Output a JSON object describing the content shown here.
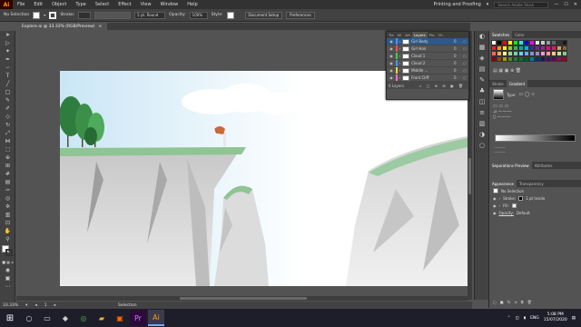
{
  "app": {
    "logo": "Ai",
    "menus": [
      "File",
      "Edit",
      "Object",
      "Type",
      "Select",
      "Effect",
      "View",
      "Window",
      "Help"
    ],
    "workspace": "Printing and Proofing",
    "search_placeholder": "Search Adobe Stock"
  },
  "control": {
    "selection": "No Selection",
    "stroke_label": "Stroke:",
    "stroke_value": "",
    "brush_value": "5 pt. Round",
    "opacity_label": "Opacity:",
    "opacity_value": "100%",
    "style_label": "Style:",
    "doc_setup": "Document Setup",
    "preferences": "Preferences"
  },
  "document": {
    "tab_title": "Explore.ai @ 33.33% (RGB/Preview)",
    "close": "×"
  },
  "layers_panel": {
    "tabs": [
      "Tra",
      "Ali",
      "Art",
      "Layers",
      "Pro",
      "Ch"
    ],
    "active_tab": "Layers",
    "layers": [
      {
        "name": "Girl Body",
        "count": "0",
        "color": "#4f8fff",
        "selected": true
      },
      {
        "name": "Girl Hair",
        "count": "0",
        "color": "#ff5050",
        "selected": false
      },
      {
        "name": "Cloud 1",
        "count": "0",
        "color": "#3fd04f",
        "selected": false
      },
      {
        "name": "Cloud 2",
        "count": "0",
        "color": "#4f8fff",
        "selected": false
      },
      {
        "name": "Middle ...",
        "count": "0",
        "color": "#ffcf3f",
        "selected": false
      },
      {
        "name": "Front Cliff",
        "count": "0",
        "color": "#ff6fd0",
        "selected": false
      }
    ],
    "footer": "6 Layers"
  },
  "right_panels": {
    "swatches_tabs": [
      "Swatches",
      "Color"
    ],
    "swatch_colors": [
      "#ffffff",
      "#000000",
      "#ff0000",
      "#ffff00",
      "#00ff00",
      "#00ffff",
      "#0000ff",
      "#ff00ff",
      "#e6e6e6",
      "#cccccc",
      "#999999",
      "#666666",
      "#333333",
      "#1a1a1a",
      "#ed1c24",
      "#f7941d",
      "#fff200",
      "#8dc63f",
      "#39b54a",
      "#00a99d",
      "#00aeef",
      "#2e3192",
      "#662d91",
      "#92278f",
      "#ec008c",
      "#ed145b",
      "#c69c6d",
      "#8c6239",
      "#f26c4f",
      "#fbaf5d",
      "#fff799",
      "#a3d39c",
      "#7accc8",
      "#6dcff6",
      "#7da7d9",
      "#8493ca",
      "#a187be",
      "#f49ac1",
      "#f5989d",
      "#fdc689",
      "#c4df9b",
      "#82ca9c",
      "#8b0000",
      "#a0410d",
      "#aba000",
      "#598527",
      "#197b30",
      "#007236",
      "#005e20",
      "#0076a3",
      "#003471",
      "#1b1464",
      "#440e62",
      "#630460",
      "#9e005d",
      "#a0001f"
    ],
    "stroke_tab": "Stroke",
    "gradient_tab": "Gradient",
    "gradient_type_label": "Type:",
    "sep_tabs": [
      "Separations Preview",
      "Attributes"
    ],
    "appearance_tabs": [
      "Appearance",
      "Transparency"
    ],
    "appearance_title": "No Selection",
    "appearance_stroke_label": "Stroke:",
    "appearance_stroke_value": "1 pt  Inside",
    "appearance_fill_label": "Fill:",
    "appearance_opacity_label": "Opacity:",
    "appearance_opacity_value": "Default",
    "fx_label": "fx"
  },
  "status": {
    "zoom": "33.33%",
    "page": "1",
    "tool": "Selection"
  },
  "taskbar": {
    "lang": "ENG",
    "time": "5:08 PM",
    "date": "15/07/2020"
  },
  "colors": {
    "sky_top": "#d8ecf6",
    "sky_bottom": "#ffffff",
    "cliff_dark": "#b0b0b0",
    "cliff_light": "#d9d9d9",
    "grass": "#8fc495",
    "tree_dark": "#2f7d3e",
    "tree_light": "#4faa5b"
  }
}
